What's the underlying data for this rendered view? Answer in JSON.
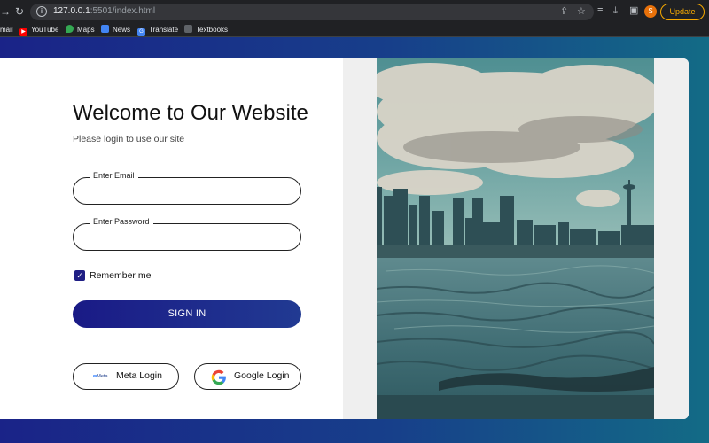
{
  "browser": {
    "url_host": "127.0.0.1",
    "url_rest": ":5501/index.html",
    "update_label": "Update",
    "profile_initial": "S",
    "bookmarks": [
      {
        "label": "mail",
        "icon": "gmail-icon",
        "color": "#ea4335"
      },
      {
        "label": "YouTube",
        "icon": "youtube-icon",
        "color": "#ff0000"
      },
      {
        "label": "Maps",
        "icon": "maps-icon",
        "color": "#34a853"
      },
      {
        "label": "News",
        "icon": "news-icon",
        "color": "#4285f4"
      },
      {
        "label": "Translate",
        "icon": "translate-icon",
        "color": "#4285f4"
      },
      {
        "label": "Textbooks",
        "icon": "textbooks-icon",
        "color": "#9aa0a6"
      }
    ]
  },
  "login": {
    "title": "Welcome to Our Website",
    "subtitle": "Please login to use our site",
    "email_label": "Enter Email",
    "email_value": "",
    "password_label": "Enter Password",
    "password_value": "",
    "remember_label": "Remember me",
    "remember_checked": true,
    "signin_label": "SIGN IN",
    "meta_logo_text": "Meta",
    "meta_label": "Meta Login",
    "google_label": "Google Login"
  },
  "colors": {
    "accent": "#1f1e84",
    "page_gradient_start": "#1a2388",
    "page_gradient_end": "#136b86",
    "update_accent": "#f9ab00"
  }
}
